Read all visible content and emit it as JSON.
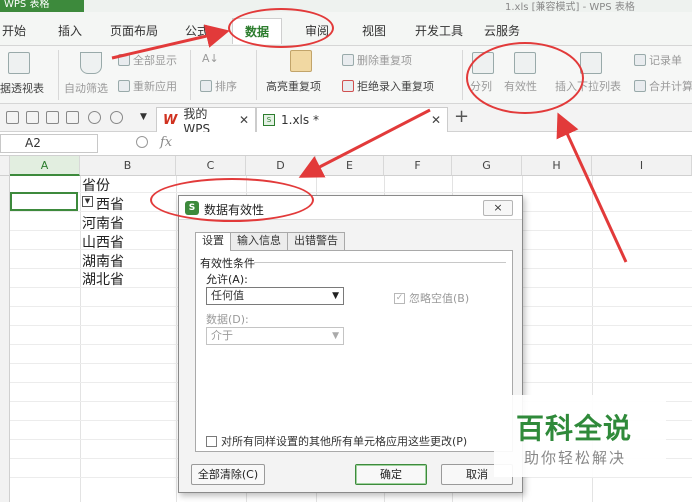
{
  "app": {
    "name": "WPS 表格",
    "title": "1.xls   [兼容模式] - WPS 表格"
  },
  "menu": {
    "tabs": [
      "开始",
      "插入",
      "页面布局",
      "公式",
      "数据",
      "审阅",
      "视图",
      "开发工具",
      "云服务"
    ],
    "active": "数据"
  },
  "ribbon": {
    "pivot": "据透视表",
    "autofilter": "自动筛选",
    "show_all": "全部显示",
    "reapply": "重新应用",
    "sort_asc": "A↓",
    "sort": "排序",
    "highlight_dup": "高亮重复项",
    "delete_dup": "删除重复项",
    "reject_dup": "拒绝录入重复项",
    "split": "分列",
    "validity": "有效性",
    "insert_dropdown": "插入下拉列表",
    "merge_calc": "合并计算",
    "record": "记录单"
  },
  "docs": {
    "mywps": "我的WPS",
    "file": "1.xls *"
  },
  "formula_bar": {
    "cell_ref": "A2",
    "fx": "fx"
  },
  "grid": {
    "columns": [
      "A",
      "B",
      "C",
      "D",
      "E",
      "F",
      "G",
      "H",
      "I"
    ],
    "selected_column": "A",
    "b_values": [
      "省份",
      "西省",
      "河南省",
      "山西省",
      "湖南省",
      "湖北省"
    ]
  },
  "dialog": {
    "title": "数据有效性",
    "close": "×",
    "tabs": [
      "设置",
      "输入信息",
      "出错警告"
    ],
    "group": "有效性条件",
    "allow_label": "允许(A):",
    "allow_value": "任何值",
    "ignore_blank": "忽略空值(B)",
    "data_label": "数据(D):",
    "data_value": "介于",
    "apply_all": "对所有同样设置的其他所有单元格应用这些更改(P)",
    "clear_all": "全部清除(C)",
    "ok": "确定",
    "cancel": "取消"
  },
  "watermark": {
    "main": "百科全说",
    "sub": "助你轻松解决"
  },
  "colors": {
    "accent": "#3d8a3c",
    "annotation": "#e23a3a"
  }
}
